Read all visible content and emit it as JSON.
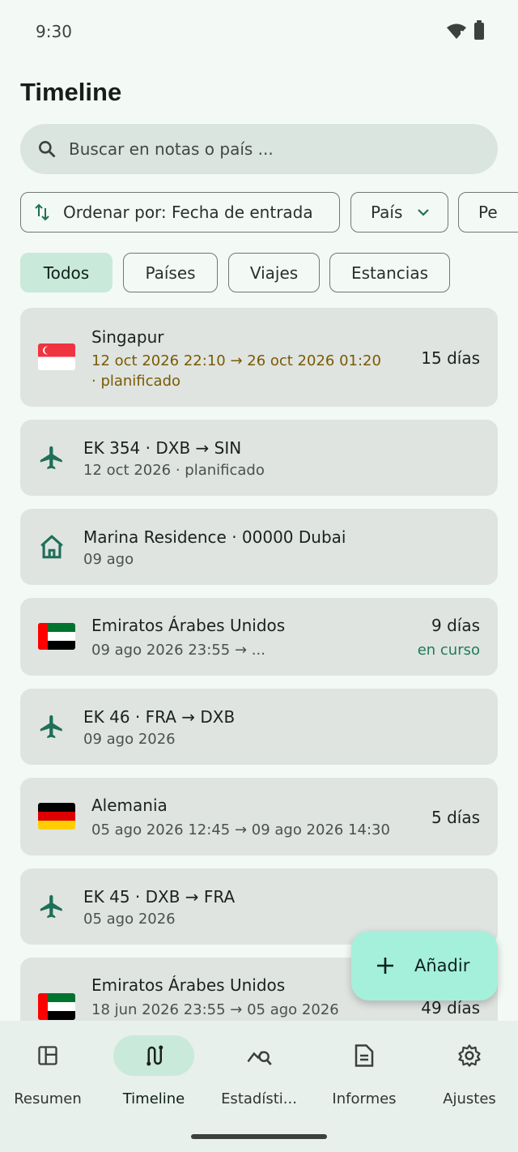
{
  "status": {
    "time": "9:30"
  },
  "title": "Timeline",
  "search": {
    "placeholder": "Buscar en notas o país ..."
  },
  "filters": {
    "sort_label": "Ordenar por: Fecha de entrada",
    "country_label": "País",
    "period_label": "Pe"
  },
  "tabs": [
    {
      "label": "Todos",
      "active": true
    },
    {
      "label": "Países",
      "active": false
    },
    {
      "label": "Viajes",
      "active": false
    },
    {
      "label": "Estancias",
      "active": false
    }
  ],
  "items": [
    {
      "kind": "country",
      "flag": "SG",
      "title": "Singapur",
      "sub1": "12 oct 2026 22:10  →  26 oct 2026 01:20",
      "sub2": "· planificado",
      "duration": "15 días"
    },
    {
      "kind": "flight",
      "title": "EK 354 · DXB → SIN",
      "sub1": "12 oct 2026 · planificado"
    },
    {
      "kind": "stay",
      "title": "Marina Residence · 00000 Dubai",
      "sub1": "09 ago"
    },
    {
      "kind": "country",
      "flag": "AE",
      "title": "Emiratos Árabes Unidos",
      "sub1": "09 ago 2026 23:55  →  ...",
      "duration": "9 días",
      "status": "en curso"
    },
    {
      "kind": "flight",
      "title": "EK 46 · FRA → DXB",
      "sub1": "09 ago 2026"
    },
    {
      "kind": "country",
      "flag": "DE",
      "title": "Alemania",
      "sub1": "05 ago 2026 12:45  →  09 ago 2026 14:30",
      "duration": "5 días"
    },
    {
      "kind": "flight",
      "title": "EK 45 · DXB → FRA",
      "sub1": "05 ago 2026"
    },
    {
      "kind": "country",
      "flag": "AE",
      "title": "Emiratos Árabes Unidos",
      "sub1": "18 jun 2026 23:55  →  05 ago 2026",
      "duration": "49 días"
    }
  ],
  "fab": {
    "label": "Añadir"
  },
  "nav": [
    {
      "label": "Resumen",
      "icon": "dashboard-icon",
      "active": false
    },
    {
      "label": "Timeline",
      "icon": "route-icon",
      "active": true
    },
    {
      "label": "Estadísti...",
      "icon": "analytics-icon",
      "active": false
    },
    {
      "label": "Informes",
      "icon": "document-icon",
      "active": false
    },
    {
      "label": "Ajustes",
      "icon": "gear-icon",
      "active": false
    }
  ],
  "colors": {
    "accent": "#1f6f58",
    "planned": "#7a5a00",
    "fab": "#a5f0da",
    "active_chip": "#c9e9db"
  }
}
